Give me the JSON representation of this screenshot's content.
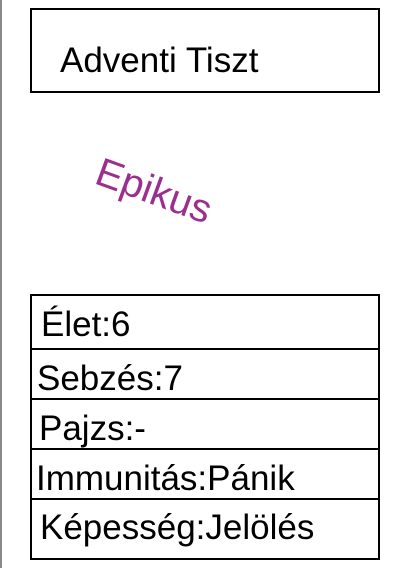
{
  "card": {
    "name": "Adventi Tiszt",
    "rarity": "Epikus",
    "rarity_color": "#9b2f8f",
    "stats": [
      {
        "label": "Élet",
        "value": "6",
        "text": "Élet:6"
      },
      {
        "label": "Sebzés",
        "value": "7",
        "text": "Sebzés:7"
      },
      {
        "label": "Pajzs",
        "value": "-",
        "text": "Pajzs:-"
      },
      {
        "label": "Immunitás",
        "value": "Pánik",
        "text": "Immunitás:Pánik"
      },
      {
        "label": "Képesség",
        "value": "Jelölés",
        "text": "Képesség:Jelölés"
      }
    ]
  }
}
